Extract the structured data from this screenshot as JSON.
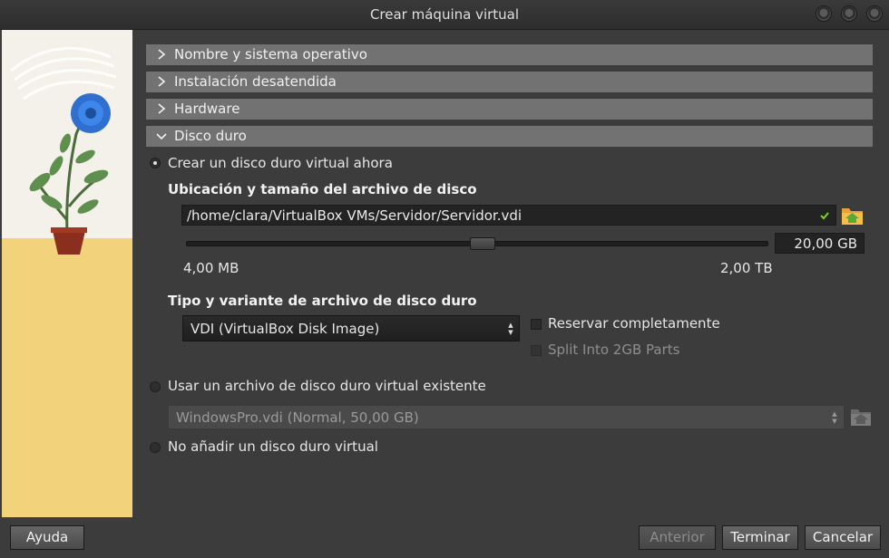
{
  "window": {
    "title": "Crear máquina virtual"
  },
  "sections": [
    {
      "label": "Nombre y sistema operativo",
      "expanded": false
    },
    {
      "label": "Instalación desatendida",
      "expanded": false
    },
    {
      "label": "Hardware",
      "expanded": false
    },
    {
      "label": "Disco duro",
      "expanded": true
    }
  ],
  "disk": {
    "option_create": "Crear un disco duro virtual ahora",
    "location_heading": "Ubicación y tamaño del archivo de disco",
    "path": "/home/clara/VirtualBox VMs/Servidor/Servidor.vdi",
    "size_value": "20,00 GB",
    "size_fraction": 0.51,
    "min_label": "4,00 MB",
    "max_label": "2,00 TB",
    "type_heading": "Tipo y variante de archivo de disco duro",
    "type_value": "VDI (VirtualBox Disk Image)",
    "reserve_label": "Reservar completamente",
    "split_label": "Split Into 2GB Parts",
    "option_existing": "Usar un archivo de disco duro virtual existente",
    "existing_value": "WindowsPro.vdi (Normal, 50,00 GB)",
    "option_none": "No añadir un disco duro virtual"
  },
  "buttons": {
    "help": "Ayuda",
    "back": "Anterior",
    "finish": "Terminar",
    "cancel": "Cancelar"
  },
  "colors": {
    "section_bg": "#727272",
    "window_bg": "#3c3c3c",
    "sidebar_yellow": "#f2d27a",
    "valid_check": "#7ed321"
  },
  "icons": [
    "chevron-right-icon",
    "chevron-down-icon",
    "check-icon",
    "folder-icon",
    "spin-arrows-icon"
  ]
}
